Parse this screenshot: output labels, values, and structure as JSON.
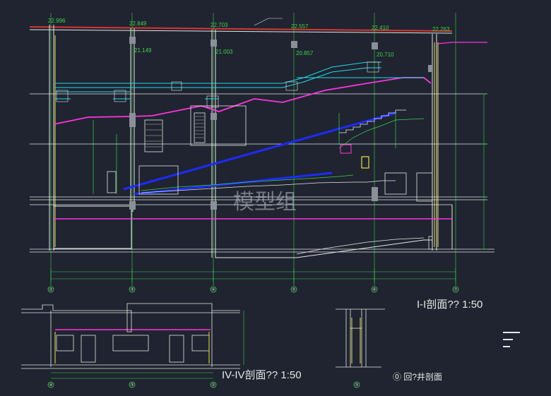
{
  "colors": {
    "background": "#1f2430",
    "line_white": "#e6e6e6",
    "line_green": "#3fd14a",
    "line_yellow": "#e8e14a",
    "line_magenta": "#ff33dd",
    "line_blue": "#1c2bff",
    "line_cyan": "#23d8e8",
    "line_red": "#d9362f",
    "watermark": "#b8bcc8"
  },
  "elevations_top": [
    "22.996",
    "22.849",
    "22.703",
    "22.557",
    "22.410",
    "22.263"
  ],
  "elevations_mid": [
    "21.149",
    "21.003",
    "20.857",
    "20.710"
  ],
  "grid_bubbles_main": [
    "②",
    "③",
    "④",
    "⑤",
    "⑥",
    "⑦"
  ],
  "grid_bubbles_iv": [
    "④",
    "③",
    "②"
  ],
  "grid_bubble_shaft": "③",
  "title_main": "I-I剖面??   1:50",
  "title_iv": "IV-IV剖面??   1:50",
  "title_shaft": "⓪ 回?井剖面",
  "watermark": "模型组"
}
